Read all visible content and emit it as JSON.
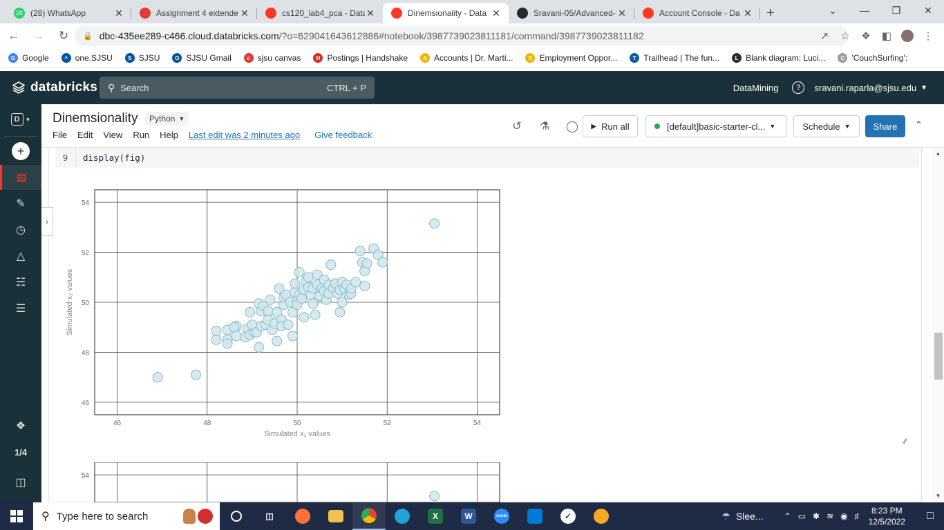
{
  "browser": {
    "tabs": [
      {
        "title": "(28) WhatsApp",
        "badge": "28",
        "color": "#25d366"
      },
      {
        "title": "Assignment 4 extende",
        "badge": "",
        "color": "#e53935"
      },
      {
        "title": "cs120_lab4_pca - Data",
        "badge": "",
        "color": "#ff3621"
      },
      {
        "title": "Dinemsionality - Data",
        "badge": "",
        "color": "#ff3621"
      },
      {
        "title": "Sravani-05/Advanced-",
        "badge": "",
        "color": "#24292f"
      },
      {
        "title": "Account Console - Da",
        "badge": "",
        "color": "#ff3621"
      }
    ],
    "active_tab": 3,
    "url_host": "dbc-435ee289-c466.cloud.databricks.com",
    "url_rest": "/?o=629041643612886#notebook/3987739023811181/command/3987739023811182",
    "bookmarks": [
      {
        "label": "Google",
        "color": "#4285f4",
        "glyph": "G"
      },
      {
        "label": "one.SJSU",
        "color": "#0055a2",
        "glyph": "^"
      },
      {
        "label": "SJSU",
        "color": "#0055a2",
        "glyph": "S"
      },
      {
        "label": "SJSU Gmail",
        "color": "#0055a2",
        "glyph": "O"
      },
      {
        "label": "sjsu canvas",
        "color": "#e53935",
        "glyph": "c"
      },
      {
        "label": "Postings | Handshake",
        "color": "#d93025",
        "glyph": "H"
      },
      {
        "label": "Accounts | Dr. Marti...",
        "color": "#f4b400",
        "glyph": "A"
      },
      {
        "label": "Employment Oppor...",
        "color": "#f4b400",
        "glyph": "E"
      },
      {
        "label": "Trailhead | The fun...",
        "color": "#0b5cab",
        "glyph": "T"
      },
      {
        "label": "Blank diagram: Luci...",
        "color": "#282c33",
        "glyph": "L"
      },
      {
        "label": "'CouchSurfing':",
        "color": "#9aa0a6",
        "glyph": "C"
      }
    ]
  },
  "databricks": {
    "brand": "databricks",
    "search_placeholder": "Search",
    "search_shortcut": "CTRL + P",
    "workspace": "DataMining",
    "user": "sravani.raparla@sjsu.edu",
    "sidebar_counter": "1/4"
  },
  "notebook": {
    "title": "Dinemsionality",
    "language": "Python",
    "menu": [
      "File",
      "Edit",
      "View",
      "Run",
      "Help"
    ],
    "last_edit": "Last edit was 2 minutes ago",
    "feedback": "Give feedback",
    "run_all": "Run all",
    "cluster": "[default]basic-starter-cl...",
    "schedule": "Schedule",
    "share": "Share",
    "code_line_number": "9",
    "code_line": "display(fig)"
  },
  "chart_data": [
    {
      "type": "scatter",
      "xlabel": "Simulated x₁ values",
      "ylabel": "Simulated x₂ values",
      "xlim": [
        45.5,
        54.5
      ],
      "ylim": [
        45.5,
        54.5
      ],
      "xticks": [
        46,
        48,
        50,
        52,
        54
      ],
      "yticks": [
        46,
        48,
        50,
        52,
        54
      ],
      "grid": true,
      "marker_color": "#cfe8ee",
      "marker_edge": "#8fb8c4",
      "points": [
        [
          46.9,
          47.0
        ],
        [
          47.75,
          47.1
        ],
        [
          53.05,
          53.15
        ],
        [
          48.2,
          48.5
        ],
        [
          48.2,
          48.85
        ],
        [
          48.45,
          48.9
        ],
        [
          48.45,
          48.5
        ],
        [
          48.45,
          48.35
        ],
        [
          48.65,
          49.05
        ],
        [
          48.6,
          49.0
        ],
        [
          48.65,
          48.65
        ],
        [
          48.85,
          48.6
        ],
        [
          48.9,
          48.95
        ],
        [
          48.95,
          48.7
        ],
        [
          48.95,
          49.6
        ],
        [
          49.05,
          48.8
        ],
        [
          49.0,
          49.1
        ],
        [
          49.1,
          48.8
        ],
        [
          49.15,
          48.2
        ],
        [
          49.15,
          49.95
        ],
        [
          49.2,
          49.05
        ],
        [
          49.2,
          49.65
        ],
        [
          49.25,
          49.85
        ],
        [
          49.3,
          49.1
        ],
        [
          49.35,
          49.3
        ],
        [
          49.35,
          49.65
        ],
        [
          49.4,
          50.1
        ],
        [
          49.45,
          48.9
        ],
        [
          49.5,
          49.15
        ],
        [
          49.55,
          48.45
        ],
        [
          49.55,
          49.6
        ],
        [
          49.6,
          50.55
        ],
        [
          49.65,
          49.3
        ],
        [
          49.65,
          49.05
        ],
        [
          49.7,
          49.9
        ],
        [
          49.7,
          50.2
        ],
        [
          49.75,
          50.3
        ],
        [
          49.8,
          49.1
        ],
        [
          49.85,
          50.0
        ],
        [
          49.9,
          48.65
        ],
        [
          49.9,
          49.6
        ],
        [
          49.95,
          50.4
        ],
        [
          49.95,
          50.75
        ],
        [
          50.0,
          50.05
        ],
        [
          50.0,
          49.9
        ],
        [
          50.05,
          50.3
        ],
        [
          50.05,
          51.2
        ],
        [
          50.1,
          50.15
        ],
        [
          50.15,
          50.5
        ],
        [
          50.15,
          49.4
        ],
        [
          50.2,
          50.85
        ],
        [
          50.25,
          50.6
        ],
        [
          50.25,
          51.0
        ],
        [
          50.3,
          50.3
        ],
        [
          50.35,
          50.55
        ],
        [
          50.35,
          49.95
        ],
        [
          50.4,
          49.5
        ],
        [
          50.45,
          50.7
        ],
        [
          50.45,
          51.1
        ],
        [
          50.5,
          50.25
        ],
        [
          50.55,
          50.55
        ],
        [
          50.6,
          50.45
        ],
        [
          50.6,
          50.9
        ],
        [
          50.65,
          50.1
        ],
        [
          50.7,
          50.7
        ],
        [
          50.7,
          50.35
        ],
        [
          50.75,
          51.5
        ],
        [
          50.8,
          50.55
        ],
        [
          50.85,
          50.75
        ],
        [
          50.9,
          50.35
        ],
        [
          50.95,
          50.5
        ],
        [
          50.95,
          49.6
        ],
        [
          51.0,
          50.0
        ],
        [
          51.0,
          50.8
        ],
        [
          51.05,
          50.55
        ],
        [
          51.1,
          50.7
        ],
        [
          51.15,
          50.3
        ],
        [
          51.2,
          50.35
        ],
        [
          51.2,
          50.55
        ],
        [
          51.3,
          50.8
        ],
        [
          51.4,
          52.05
        ],
        [
          51.45,
          51.6
        ],
        [
          51.5,
          50.65
        ],
        [
          51.5,
          51.25
        ],
        [
          51.55,
          51.55
        ],
        [
          51.7,
          52.15
        ],
        [
          51.8,
          51.9
        ],
        [
          51.9,
          51.6
        ]
      ]
    },
    {
      "type": "scatter",
      "xlim": [
        45.5,
        54.5
      ],
      "ylim": [
        45.5,
        54.5
      ],
      "yticks": [
        54
      ],
      "grid": true,
      "marker_color": "#cfe8ee",
      "marker_edge": "#8fb8c4",
      "points": [
        [
          53.05,
          53.15
        ]
      ]
    }
  ],
  "taskbar": {
    "search_placeholder": "Type here to search",
    "weather": "Slee...",
    "time": "8:23 PM",
    "date": "12/5/2022"
  }
}
